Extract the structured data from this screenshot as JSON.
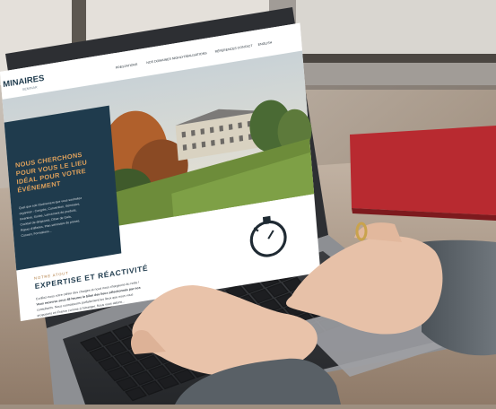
{
  "site": {
    "logo_main": "MINAIRES",
    "logo_sub": "SEMINAR",
    "nav": [
      "PRESTATIONS",
      "NOS DOMAINES NIGHLY",
      "RÉALISATIONS",
      "RÉFÉRENCES",
      "CONTACT",
      "ENGLISH"
    ],
    "hero_title_lines": [
      "NOUS CHERCHONS",
      "POUR VOUS LE LIEU",
      "IDÉAL POUR VOTRE",
      "ÉVÉNEMENT"
    ],
    "hero_body_lines": [
      "Quel que soit l'événement que vous souhaitez",
      "organiser : Congrès, Convention, Séminaire,",
      "Incentive, Soirée, Lancement de produits,",
      "Cocktail de dirigeants, Dîner de Gala,",
      "Repas d'affaires, Plan séminaire de presse,",
      "Concert, Formations..."
    ],
    "section_kicker": "NOTRE ATOUT",
    "section_title": "EXPERTISE ET RÉACTIVITÉ",
    "section_body_lines": [
      "Confiez-nous votre cahier des charges et nous nous chargeons du reste !",
      "Vous recevrez sous 48 heures le bilan des lieux sélectionnés par nos",
      "consultants. Nous connaissons parfaitement les lieux que nous vous",
      "proposons en France comme à l'étranger. Nous vous aidons..."
    ]
  },
  "colors": {
    "hero_panel": "#1f3b4d",
    "hero_title": "#e0a25c",
    "screen_bg": "#ffffff",
    "laptop_body": "#2b2d31",
    "table": "#b5a596",
    "red_book": "#c0282f"
  }
}
